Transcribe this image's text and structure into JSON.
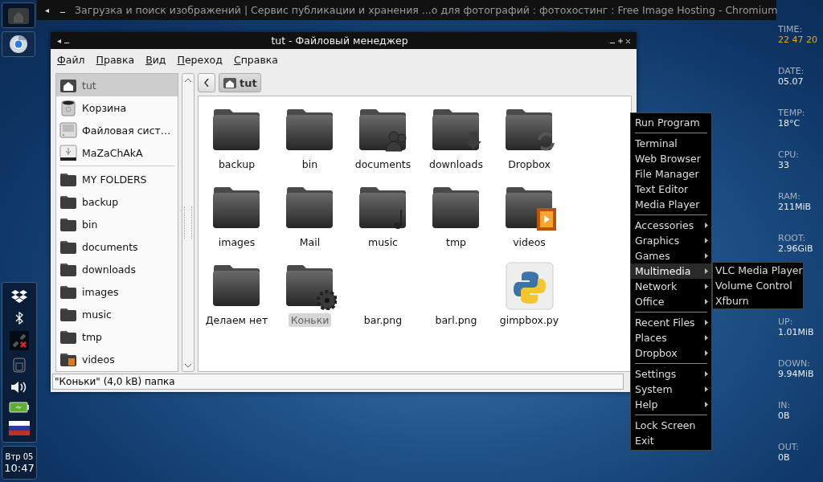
{
  "browser_bar": {
    "title": "Загрузка и поиск изображений | Сервис публикации и хранения ...о для фотографий : фотохостинг : Free Image Hosting - Chromium"
  },
  "clock": {
    "day": "Втр 05",
    "time": "10:47"
  },
  "file_manager": {
    "title": "tut - Файловый менеджер",
    "menu": [
      "Файл",
      "Правка",
      "Вид",
      "Переход",
      "Справка"
    ],
    "devices": [
      {
        "label": "tut",
        "kind": "home",
        "selected": true
      },
      {
        "label": "Корзина",
        "kind": "trash",
        "selected": false
      },
      {
        "label": "Файловая сист…",
        "kind": "drive",
        "selected": false
      },
      {
        "label": "MaZaChAkA",
        "kind": "usb",
        "selected": false
      }
    ],
    "bookmarks": [
      {
        "label": "MY FOLDERS",
        "kind": "folder",
        "selected": false
      },
      {
        "label": "backup",
        "kind": "folder",
        "selected": false
      },
      {
        "label": "bin",
        "kind": "folder",
        "selected": false
      },
      {
        "label": "documents",
        "kind": "folder-people",
        "selected": false
      },
      {
        "label": "downloads",
        "kind": "folder-download",
        "selected": false
      },
      {
        "label": "images",
        "kind": "folder",
        "selected": false
      },
      {
        "label": "music",
        "kind": "folder-note",
        "selected": false
      },
      {
        "label": "tmp",
        "kind": "folder",
        "selected": false
      },
      {
        "label": "videos",
        "kind": "folder-film",
        "selected": false
      }
    ],
    "path": "tut",
    "items": [
      {
        "name": "backup",
        "kind": "folder",
        "selected": false
      },
      {
        "name": "bin",
        "kind": "folder",
        "selected": false
      },
      {
        "name": "documents",
        "kind": "folder-people",
        "selected": false
      },
      {
        "name": "downloads",
        "kind": "folder-download",
        "selected": false
      },
      {
        "name": "Dropbox",
        "kind": "folder-sync",
        "selected": false
      },
      {
        "name": "images",
        "kind": "folder",
        "selected": false
      },
      {
        "name": "Mail",
        "kind": "folder",
        "selected": false
      },
      {
        "name": "music",
        "kind": "folder-note",
        "selected": false
      },
      {
        "name": "tmp",
        "kind": "folder",
        "selected": false
      },
      {
        "name": "videos",
        "kind": "folder-film",
        "selected": false
      },
      {
        "name": "Делаем нет",
        "kind": "folder",
        "selected": false
      },
      {
        "name": "Коньки",
        "kind": "folder-gear",
        "selected": true
      },
      {
        "name": "bar.png",
        "kind": "blank",
        "selected": false
      },
      {
        "name": "barl.png",
        "kind": "blank",
        "selected": false
      },
      {
        "name": "gimpbox.py",
        "kind": "python",
        "selected": false
      }
    ],
    "status": "\"Коньки\" (4,0 kB) папка"
  },
  "menu": {
    "sections": [
      [
        {
          "label": "Run Program",
          "submenu": false,
          "selected": false
        }
      ],
      [
        {
          "label": "Terminal",
          "submenu": false,
          "selected": false
        },
        {
          "label": "Web Browser",
          "submenu": false,
          "selected": false
        },
        {
          "label": "File Manager",
          "submenu": false,
          "selected": false
        },
        {
          "label": "Text Editor",
          "submenu": false,
          "selected": false
        },
        {
          "label": "Media Player",
          "submenu": false,
          "selected": false
        }
      ],
      [
        {
          "label": "Accessories",
          "submenu": true,
          "selected": false
        },
        {
          "label": "Graphics",
          "submenu": true,
          "selected": false
        },
        {
          "label": "Games",
          "submenu": true,
          "selected": false
        },
        {
          "label": "Multimedia",
          "submenu": true,
          "selected": true
        },
        {
          "label": "Network",
          "submenu": true,
          "selected": false
        },
        {
          "label": "Office",
          "submenu": true,
          "selected": false
        }
      ],
      [
        {
          "label": "Recent Files",
          "submenu": true,
          "selected": false
        },
        {
          "label": "Places",
          "submenu": true,
          "selected": false
        },
        {
          "label": "Dropbox",
          "submenu": true,
          "selected": false
        }
      ],
      [
        {
          "label": "Settings",
          "submenu": true,
          "selected": false
        },
        {
          "label": "System",
          "submenu": true,
          "selected": false
        },
        {
          "label": "Help",
          "submenu": true,
          "selected": false
        }
      ],
      [
        {
          "label": "Lock Screen",
          "submenu": false,
          "selected": false
        },
        {
          "label": "Exit",
          "submenu": false,
          "selected": false
        }
      ]
    ],
    "submenu": [
      "VLC Media Player",
      "Volume Control",
      "Xfburn"
    ]
  },
  "stats": [
    {
      "label": "TIME:",
      "value": "22 47 20",
      "kind": "highlight"
    },
    {
      "label": "DATE:",
      "value": "05.07",
      "kind": "plain"
    },
    {
      "label": "TEMP:",
      "value": "18°C",
      "kind": "plain"
    },
    {
      "label": "CPU:",
      "value": "33",
      "kind": "plain"
    },
    {
      "label": "RAM:",
      "value": "211MiB",
      "kind": "plain"
    },
    {
      "label": "ROOT:",
      "value": "2.96GiB",
      "kind": "plain"
    },
    {
      "kind": "hidden"
    },
    {
      "label": "UP:",
      "value": "1.01MiB",
      "kind": "plain"
    },
    {
      "label": "DOWN:",
      "value": "9.94MiB",
      "kind": "plain"
    },
    {
      "label": "IN:",
      "value": "0B",
      "kind": "plain"
    },
    {
      "label": "OUT:",
      "value": "0B",
      "kind": "plain"
    }
  ]
}
